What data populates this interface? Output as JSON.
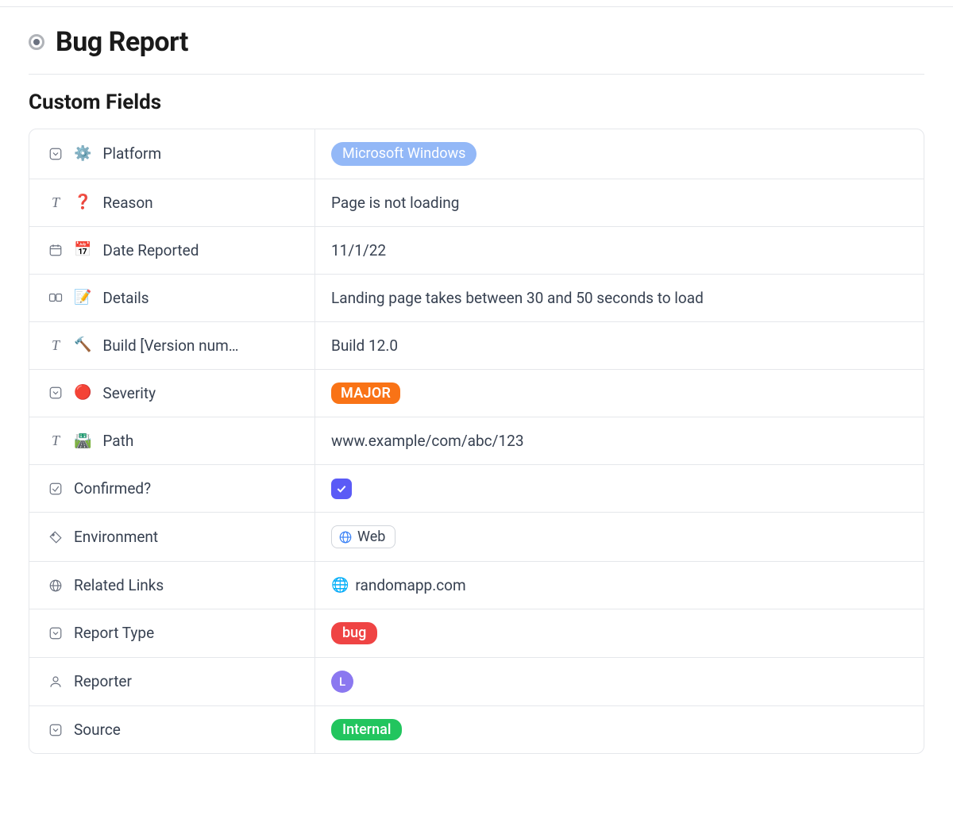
{
  "page": {
    "title": "Bug Report",
    "section_title": "Custom Fields"
  },
  "fields": {
    "platform": {
      "emoji": "⚙️",
      "label": "Platform",
      "value": "Microsoft Windows"
    },
    "reason": {
      "emoji": "❓",
      "label": "Reason",
      "value": "Page is not loading"
    },
    "date": {
      "emoji": "📅",
      "label": "Date Reported",
      "value": "11/1/22"
    },
    "details": {
      "emoji": "📝",
      "label": "Details",
      "value": "Landing page takes between 30 and 50 seconds to load"
    },
    "build": {
      "emoji": "🔨",
      "label": "Build [Version num…",
      "value": "Build 12.0"
    },
    "severity": {
      "emoji": "🔴",
      "label": "Severity",
      "value": "MAJOR"
    },
    "path": {
      "emoji": "🛣️",
      "label": "Path",
      "value": "www.example/com/abc/123"
    },
    "confirmed": {
      "label": "Confirmed?",
      "checked": true
    },
    "environment": {
      "label": "Environment",
      "value": "Web"
    },
    "links": {
      "label": "Related Links",
      "value": "randomapp.com"
    },
    "report_type": {
      "label": "Report Type",
      "value": "bug"
    },
    "reporter": {
      "label": "Reporter",
      "initial": "L"
    },
    "source": {
      "label": "Source",
      "value": "Internal"
    }
  }
}
